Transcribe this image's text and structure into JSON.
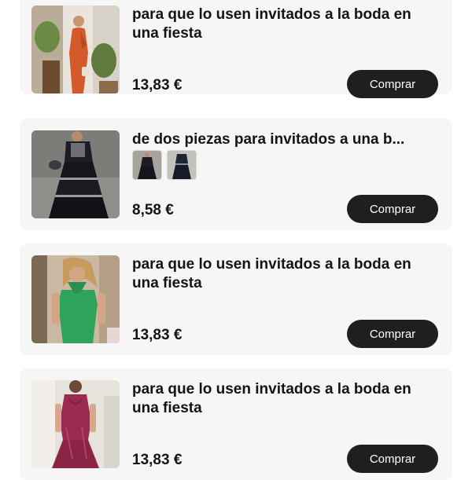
{
  "products": [
    {
      "title": "para que lo usen invitados a la boda en una fiesta",
      "price": "13,83 €",
      "button_label": "Comprar",
      "image": "woman-orange-satin-dress-photo"
    },
    {
      "title": "de dos piezas para invitados a una b...",
      "price": "8,58 €",
      "button_label": "Comprar",
      "image": "woman-black-two-piece-tiered-skirt-photo",
      "variants": [
        "variant-thumbnail-black",
        "variant-thumbnail-navy"
      ]
    },
    {
      "title": "para que lo usen invitados a la boda en una fiesta",
      "price": "13,83 €",
      "button_label": "Comprar",
      "image": "woman-green-halter-dress-photo"
    },
    {
      "title": "para que lo usen invitados a la boda en una fiesta",
      "price": "13,83 €",
      "button_label": "Comprar",
      "image": "woman-burgundy-satin-dress-photo"
    }
  ],
  "colors": {
    "card_background": "#f6f6f6",
    "button_background": "#1f1f1f",
    "button_text": "#ffffff",
    "text": "#141414"
  }
}
